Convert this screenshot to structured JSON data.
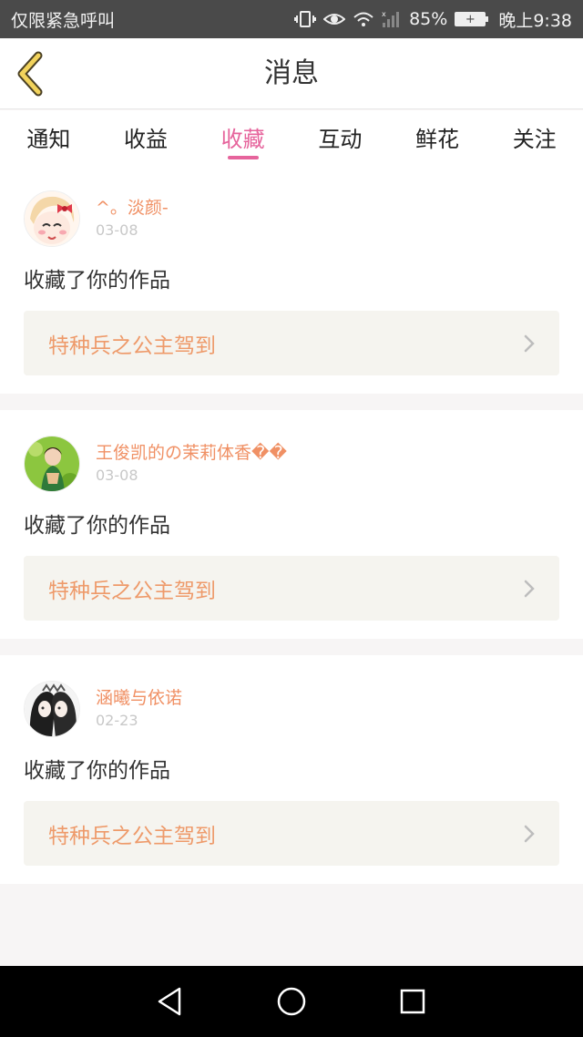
{
  "status_bar": {
    "carrier": "仅限紧急呼叫",
    "battery_percent": "85%",
    "time": "晚上9:38"
  },
  "header": {
    "title": "消息",
    "back_icon": "chevron-left-icon"
  },
  "tabs": [
    {
      "label": "通知",
      "active": false
    },
    {
      "label": "收益",
      "active": false
    },
    {
      "label": "收藏",
      "active": true
    },
    {
      "label": "互动",
      "active": false
    },
    {
      "label": "鲜花",
      "active": false
    },
    {
      "label": "关注",
      "active": false
    }
  ],
  "items": [
    {
      "username": "^。淡颜-",
      "date": "03-08",
      "action": "收藏了你的作品",
      "work_title": "特种兵之公主驾到"
    },
    {
      "username": "王俊凯的の茉莉体香��",
      "date": "03-08",
      "action": "收藏了你的作品",
      "work_title": "特种兵之公主驾到"
    },
    {
      "username": "涵曦与依诺",
      "date": "02-23",
      "action": "收藏了你的作品",
      "work_title": "特种兵之公主驾到"
    }
  ],
  "colors": {
    "accent": "#e6649c",
    "username": "#f09064",
    "work_title": "#ee9a6a"
  }
}
